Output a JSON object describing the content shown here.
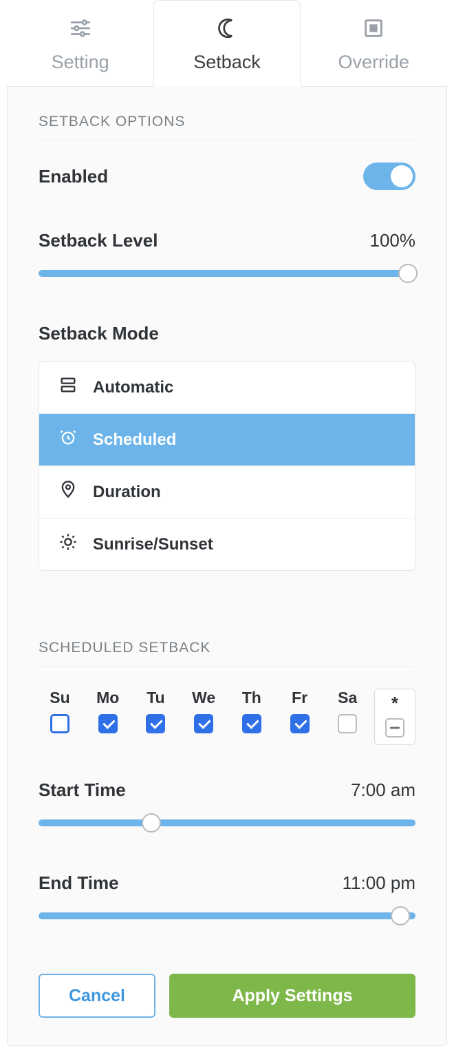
{
  "tabs": {
    "setting": "Setting",
    "setback": "Setback",
    "override": "Override"
  },
  "section1_title": "SETBACK OPTIONS",
  "enabled_label": "Enabled",
  "enabled_value": true,
  "setback_level_label": "Setback Level",
  "setback_level_value": "100%",
  "setback_level_pct": 100,
  "setback_mode_label": "Setback Mode",
  "modes": {
    "automatic": "Automatic",
    "scheduled": "Scheduled",
    "duration": "Duration",
    "sunrise": "Sunrise/Sunset"
  },
  "selected_mode": "scheduled",
  "section2_title": "SCHEDULED SETBACK",
  "days": [
    {
      "abbr": "Su",
      "checked": false,
      "focused": true
    },
    {
      "abbr": "Mo",
      "checked": true
    },
    {
      "abbr": "Tu",
      "checked": true
    },
    {
      "abbr": "We",
      "checked": true
    },
    {
      "abbr": "Th",
      "checked": true
    },
    {
      "abbr": "Fr",
      "checked": true
    },
    {
      "abbr": "Sa",
      "checked": false
    }
  ],
  "all_symbol": "*",
  "all_state": "indeterminate",
  "start_time_label": "Start Time",
  "start_time_value": "7:00 am",
  "start_time_pct": 30,
  "end_time_label": "End Time",
  "end_time_value": "11:00 pm",
  "end_time_pct": 96,
  "cancel_label": "Cancel",
  "apply_label": "Apply Settings"
}
